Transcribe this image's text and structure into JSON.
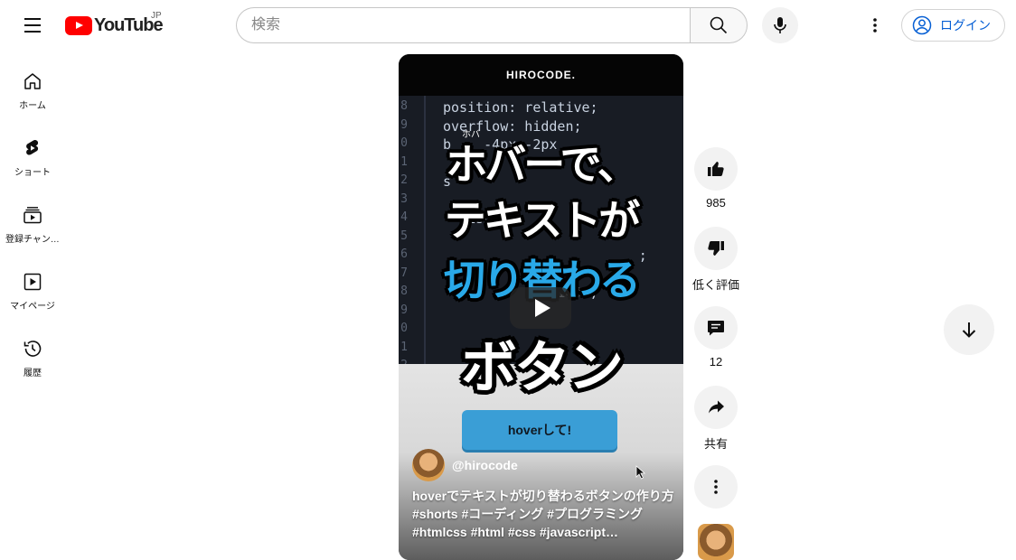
{
  "header": {
    "logo_text": "YouTube",
    "region": "JP",
    "search_placeholder": "検索",
    "login_label": "ログイン"
  },
  "guide": {
    "items": [
      {
        "label": "ホーム",
        "icon": "home-icon"
      },
      {
        "label": "ショート",
        "icon": "shorts-icon"
      },
      {
        "label": "登録チャンネル",
        "icon": "subscriptions-icon"
      },
      {
        "label": "マイページ",
        "icon": "you-icon"
      },
      {
        "label": "履歴",
        "icon": "history-icon"
      }
    ]
  },
  "short": {
    "brand": "HIROCODE.",
    "code_lines": [
      {
        "num": "8",
        "text": "position: relative;"
      },
      {
        "num": "9",
        "text": "overflow: hidden;"
      },
      {
        "num": "0",
        "text": "b    -4px -2px"
      },
      {
        "num": "1",
        "text": ""
      },
      {
        "num": "2",
        "text": "s"
      },
      {
        "num": "3",
        "text": ""
      },
      {
        "num": "4",
        "text": "  disp"
      },
      {
        "num": "5",
        "text": ""
      },
      {
        "num": "6",
        "text": "                        ;"
      },
      {
        "num": "7",
        "text": ""
      },
      {
        "num": "8",
        "text": "              100%;"
      },
      {
        "num": "9",
        "text": ""
      },
      {
        "num": "0",
        "text": ""
      },
      {
        "num": "1",
        "text": ""
      },
      {
        "num": "2",
        "text": ""
      }
    ],
    "title_ruby": "ホバ",
    "title_line1": "ホバーで、",
    "title_line2": "テキストが",
    "title_line3": "切り替わる",
    "title_line4": "ボタン",
    "demo_button": "hoverして!",
    "channel_handle": "@hirocode",
    "caption": "hoverでテキストが切り替わるボタンの作り方 #shorts #コーディング #プログラミング #htmlcss #html #css #javascript…"
  },
  "actions": {
    "like_count": "985",
    "dislike_label": "低く評価",
    "comment_count": "12",
    "share_label": "共有"
  }
}
